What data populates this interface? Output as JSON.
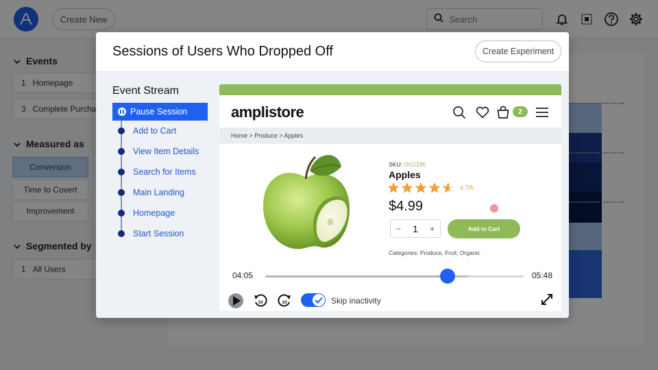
{
  "app": {
    "create_new_label": "Create New",
    "search_placeholder": "Search",
    "icons": [
      "bell-icon",
      "grid-icon",
      "help-icon",
      "gear-icon"
    ],
    "accent_color": "#1e61f0"
  },
  "left_panel": {
    "events_heading": "Events",
    "events": [
      {
        "num": "1",
        "label": "Homepage"
      },
      {
        "num": "3",
        "label": "Complete Purcha"
      }
    ],
    "measured_heading": "Measured as",
    "measures": [
      "Conversion",
      "Time to Covert",
      "Improvement"
    ],
    "segmented_heading": "Segmented by",
    "segments": [
      {
        "num": "1",
        "label": "All Users"
      }
    ]
  },
  "modal": {
    "title": "Sessions of Users Who Dropped Off",
    "create_experiment_label": "Create Experiment",
    "event_stream_title": "Event Stream",
    "pause_label": "Pause Session",
    "events": [
      "Add to Cart",
      "View Item Details",
      "Search for Items",
      "Main Landing",
      "Homepage",
      "Start Session"
    ]
  },
  "store": {
    "logo": "amplistore",
    "cart_count": "2",
    "breadcrumb": "Home  >  Produce > Apples",
    "sku_label": "SKU:",
    "sku_value": "OG1295",
    "product_name": "Apples",
    "rating": "4.7/5",
    "rating_value": 4.7,
    "price": "$4.99",
    "qty_minus": "−",
    "qty_value": "1",
    "qty_plus": "+",
    "add_to_cart_label": "Add to Cart",
    "categories": "Categories: Produce, Fruit, Organic",
    "brand_color": "#8fba59"
  },
  "player": {
    "current_time": "04:05",
    "total_time": "05:48",
    "skip_inactivity_label": "Skip inactivity",
    "skip_inactivity_on": true,
    "rewind_seconds": "10",
    "forward_seconds": "10"
  }
}
